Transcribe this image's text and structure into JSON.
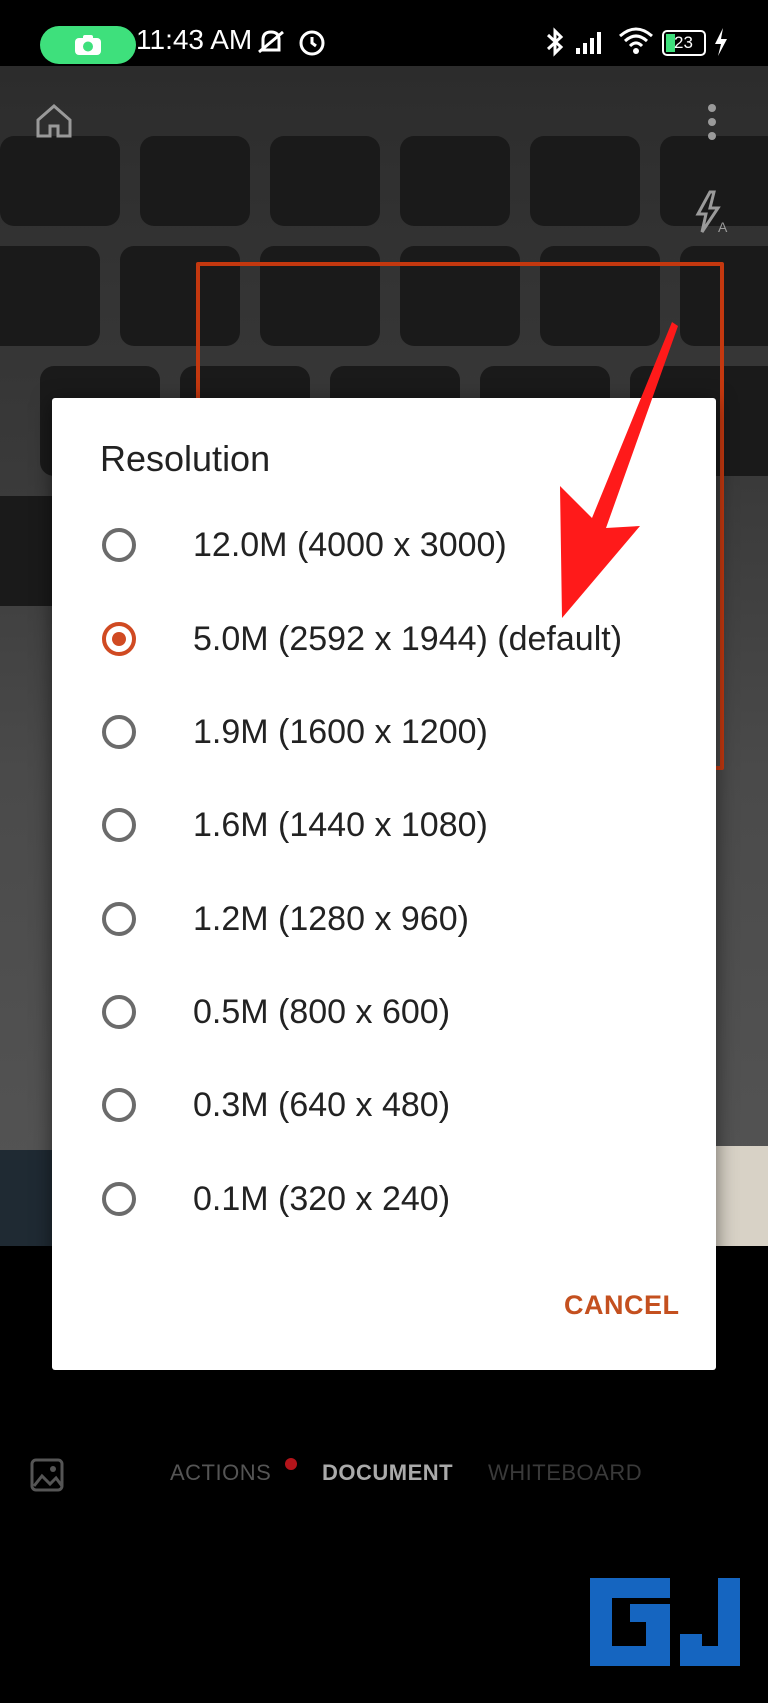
{
  "status_bar": {
    "time": "11:43 AM",
    "battery_level": "23",
    "icons": [
      "camera-icon",
      "mute-icon",
      "alarm-icon",
      "bluetooth-icon",
      "signal-icon",
      "wifi-icon",
      "battery-icon",
      "charging-icon"
    ]
  },
  "camera": {
    "top_icons": [
      "home-icon",
      "more-options-icon",
      "flash-auto-icon"
    ]
  },
  "dialog": {
    "title": "Resolution",
    "selected_index": 1,
    "options": [
      {
        "label": "12.0M (4000 x 3000)"
      },
      {
        "label": "5.0M (2592 x 1944) (default)"
      },
      {
        "label": "1.9M (1600 x 1200)"
      },
      {
        "label": "1.6M (1440 x 1080)"
      },
      {
        "label": "1.2M (1280 x 960)"
      },
      {
        "label": "0.5M (800 x 600)"
      },
      {
        "label": "0.3M (640 x 480)"
      },
      {
        "label": "0.1M (320 x 240)"
      }
    ],
    "cancel_label": "CANCEL"
  },
  "modes": {
    "actions": "ACTIONS",
    "document": "DOCUMENT",
    "whiteboard": "WHITEBOARD"
  },
  "colors": {
    "accent": "#d04a22",
    "status_pill": "#3ee07c",
    "arrow": "#ff1a1a",
    "logo": "#1565c0"
  }
}
